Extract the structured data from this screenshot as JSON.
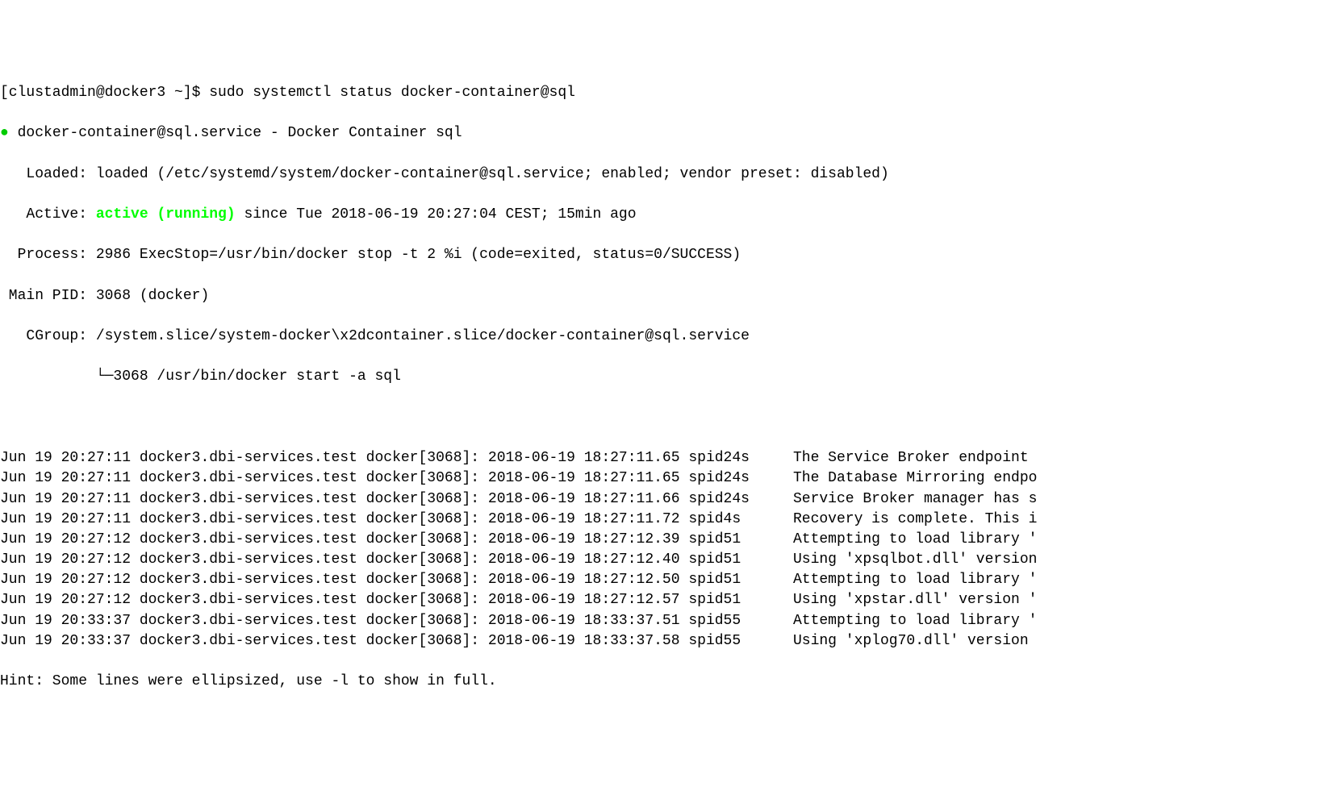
{
  "prompt": {
    "user_host": "[clustadmin@docker3 ~]$ ",
    "command": "sudo systemctl status docker-container@sql"
  },
  "header": {
    "bullet": "●",
    "unit_line": " docker-container@sql.service - Docker Container sql",
    "loaded_label": "   Loaded: ",
    "loaded_value": "loaded (/etc/systemd/system/docker-container@sql.service; enabled; vendor preset: disabled)",
    "active_label": "   Active: ",
    "active_state": "active (running)",
    "active_since": " since Tue 2018-06-19 20:27:04 CEST; 15min ago",
    "process_label": "  Process: ",
    "process_value": "2986 ExecStop=/usr/bin/docker stop -t 2 %i (code=exited, status=0/SUCCESS)",
    "mainpid_label": " Main PID: ",
    "mainpid_value": "3068 (docker)",
    "cgroup_label": "   CGroup: ",
    "cgroup_value": "/system.slice/system-docker\\x2dcontainer.slice/docker-container@sql.service",
    "cgroup_child": "           └─3068 /usr/bin/docker start -a sql"
  },
  "logs": [
    {
      "prefix": "Jun 19 20:27:11 docker3.dbi-services.test docker[3068]: 2018-06-19 18:27:11.65 spid24s     ",
      "msg": "The Service Broker endpoint "
    },
    {
      "prefix": "Jun 19 20:27:11 docker3.dbi-services.test docker[3068]: 2018-06-19 18:27:11.65 spid24s     ",
      "msg": "The Database Mirroring endpo"
    },
    {
      "prefix": "Jun 19 20:27:11 docker3.dbi-services.test docker[3068]: 2018-06-19 18:27:11.66 spid24s     ",
      "msg": "Service Broker manager has s"
    },
    {
      "prefix": "Jun 19 20:27:11 docker3.dbi-services.test docker[3068]: 2018-06-19 18:27:11.72 spid4s      ",
      "msg": "Recovery is complete. This i"
    },
    {
      "prefix": "Jun 19 20:27:12 docker3.dbi-services.test docker[3068]: 2018-06-19 18:27:12.39 spid51      ",
      "msg": "Attempting to load library '"
    },
    {
      "prefix": "Jun 19 20:27:12 docker3.dbi-services.test docker[3068]: 2018-06-19 18:27:12.40 spid51      ",
      "msg": "Using 'xpsqlbot.dll' version"
    },
    {
      "prefix": "Jun 19 20:27:12 docker3.dbi-services.test docker[3068]: 2018-06-19 18:27:12.50 spid51      ",
      "msg": "Attempting to load library '"
    },
    {
      "prefix": "Jun 19 20:27:12 docker3.dbi-services.test docker[3068]: 2018-06-19 18:27:12.57 spid51      ",
      "msg": "Using 'xpstar.dll' version '"
    },
    {
      "prefix": "Jun 19 20:33:37 docker3.dbi-services.test docker[3068]: 2018-06-19 18:33:37.51 spid55      ",
      "msg": "Attempting to load library '"
    },
    {
      "prefix": "Jun 19 20:33:37 docker3.dbi-services.test docker[3068]: 2018-06-19 18:33:37.58 spid55      ",
      "msg": "Using 'xplog70.dll' version "
    }
  ],
  "hint": "Hint: Some lines were ellipsized, use -l to show in full."
}
